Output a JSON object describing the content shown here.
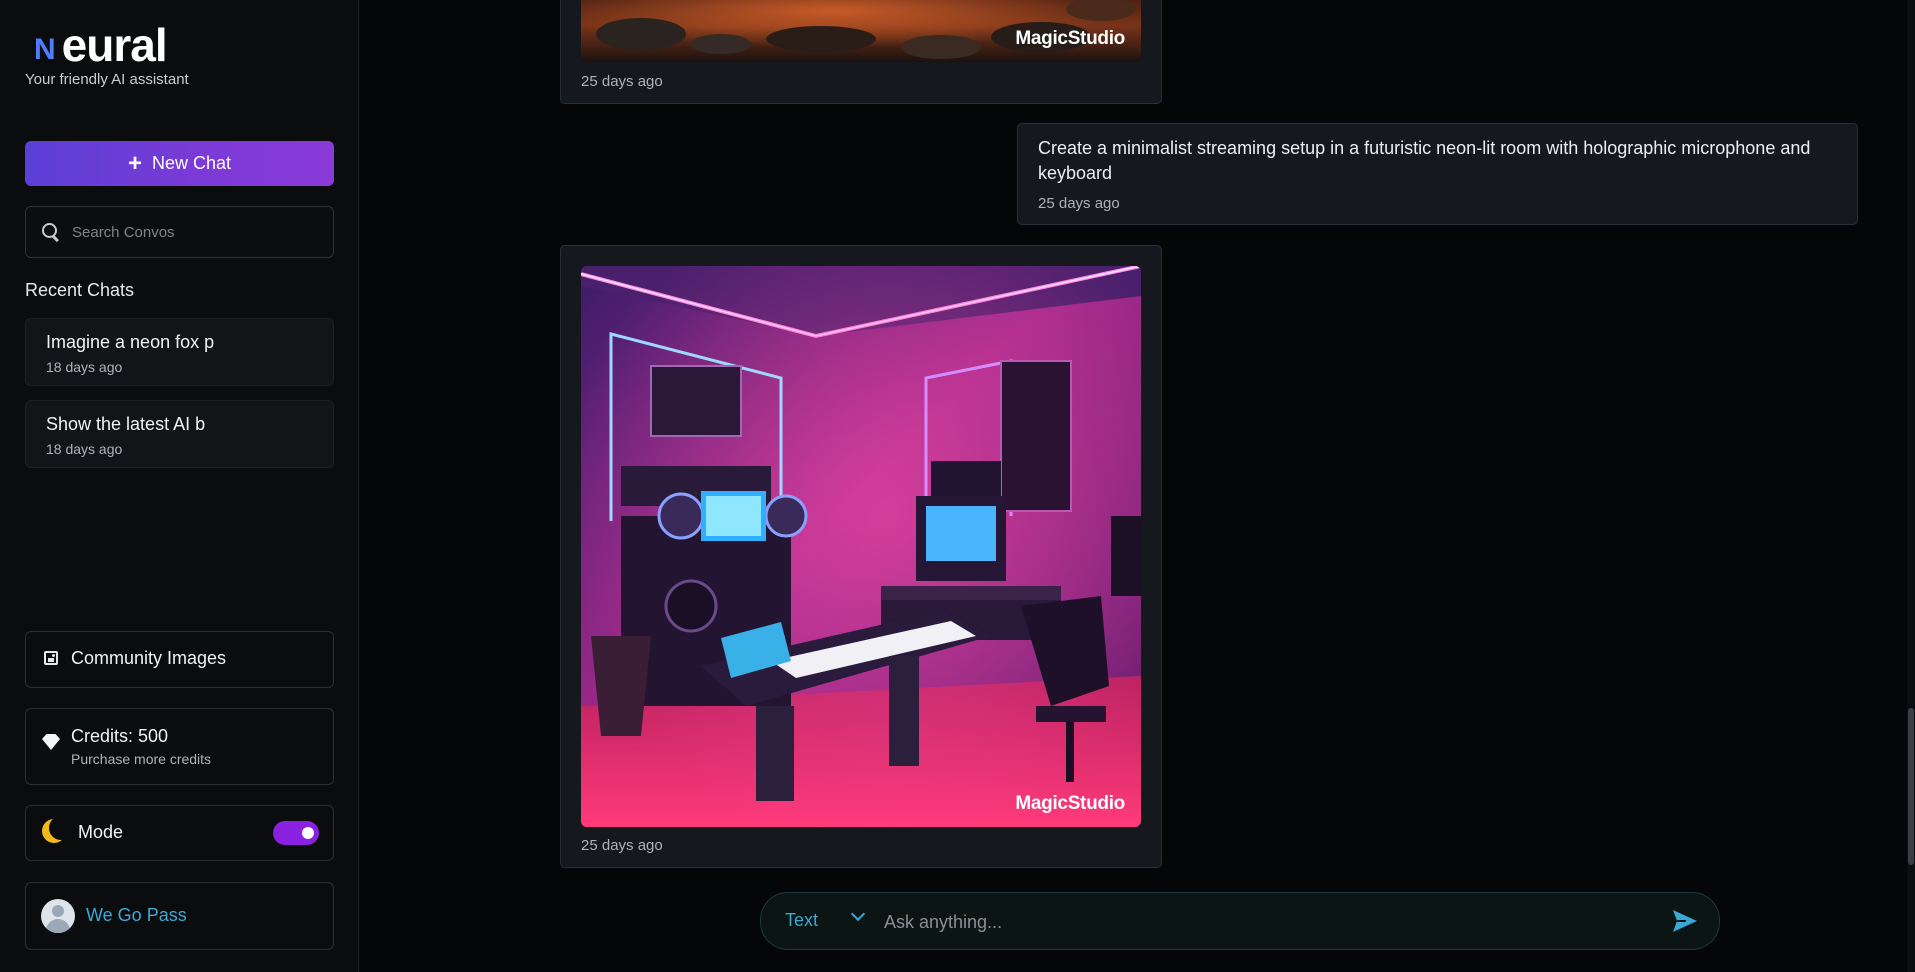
{
  "brand": {
    "logo_letter": "N",
    "name": "eural",
    "tagline": "Your friendly AI assistant"
  },
  "sidebar": {
    "new_chat_label": "New Chat",
    "search": {
      "placeholder": "Search Convos",
      "value": ""
    },
    "recent_title": "Recent Chats",
    "recent_chats": [
      {
        "title": "Imagine a neon fox p",
        "date": "18 days ago"
      },
      {
        "title": "Show the latest AI b",
        "date": "18 days ago"
      }
    ],
    "community_label": "Community Images",
    "credits_label": "Credits: 500",
    "credits_sub": "Purchase more credits",
    "mode_label": "Mode",
    "mode_toggle_on": true,
    "user_name": "We Go Pass"
  },
  "messages": [
    {
      "type": "image",
      "watermark": "MagicStudio",
      "timestamp": "25 days ago"
    },
    {
      "type": "user",
      "text": "Create a minimalist streaming setup in a futuristic neon-lit room with holographic microphone and keyboard",
      "timestamp": "25 days ago"
    },
    {
      "type": "image",
      "watermark": "MagicStudio",
      "timestamp": "25 days ago"
    }
  ],
  "composer": {
    "mode": "Text",
    "placeholder": "Ask anything...",
    "value": ""
  },
  "colors": {
    "accent_purple": "#7a3ad6",
    "accent_blue": "#3aa7d6",
    "moon": "#f3b81a",
    "toggle": "#8b21e0"
  }
}
